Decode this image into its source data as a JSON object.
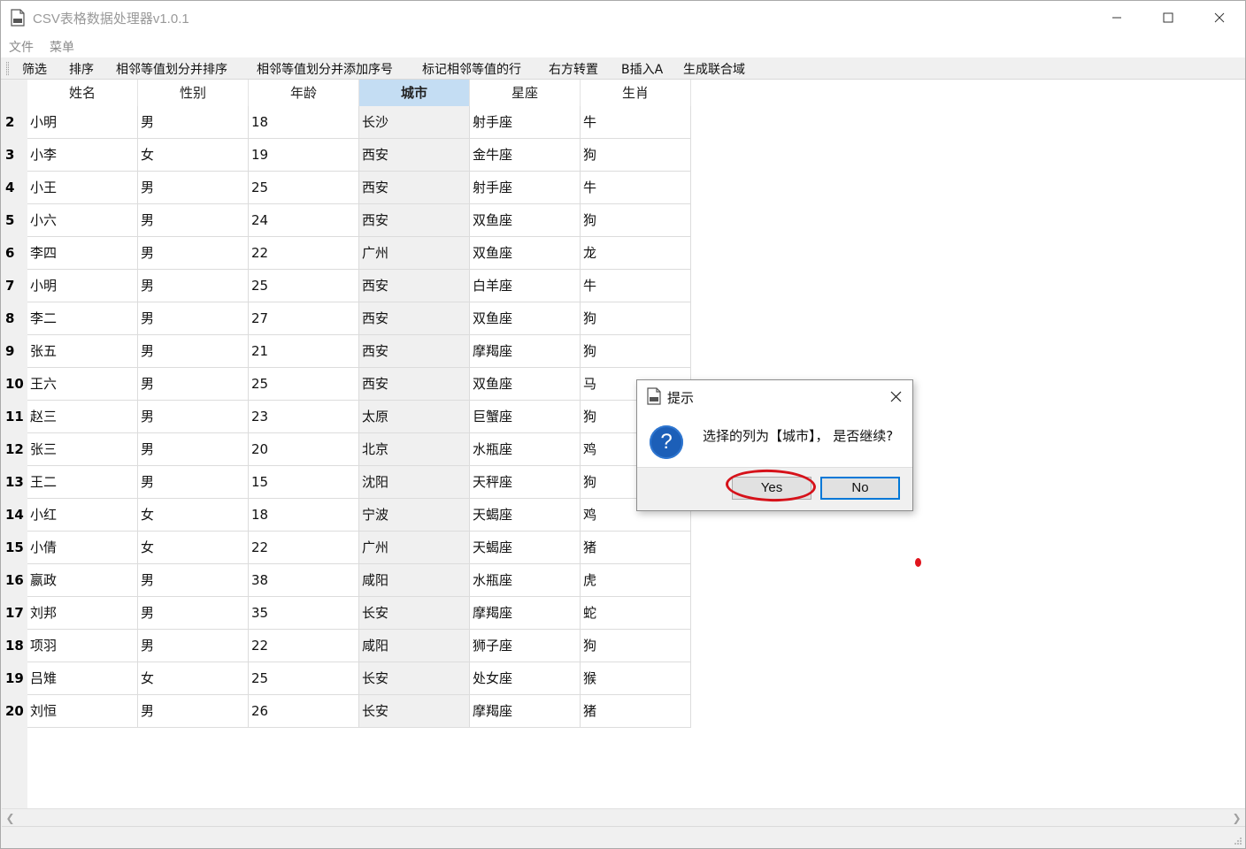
{
  "window": {
    "title": "CSV表格数据处理器v1.0.1"
  },
  "menu": {
    "items": [
      "文件",
      "菜单"
    ]
  },
  "toolbar": {
    "items": [
      "筛选",
      "排序",
      "相邻等值划分并排序",
      "相邻等值划分并添加序号",
      "标记相邻等值的行",
      "右方转置",
      "B插入A",
      "生成联合域"
    ]
  },
  "table": {
    "headers": [
      "姓名",
      "性别",
      "年龄",
      "城市",
      "星座",
      "生肖"
    ],
    "selected_column": "城市",
    "rows": [
      {
        "num": "2",
        "cells": [
          "小明",
          "男",
          "18",
          "长沙",
          "射手座",
          "牛"
        ]
      },
      {
        "num": "3",
        "cells": [
          "小李",
          "女",
          "19",
          "西安",
          "金牛座",
          "狗"
        ]
      },
      {
        "num": "4",
        "cells": [
          "小王",
          "男",
          "25",
          "西安",
          "射手座",
          "牛"
        ]
      },
      {
        "num": "5",
        "cells": [
          "小六",
          "男",
          "24",
          "西安",
          "双鱼座",
          "狗"
        ]
      },
      {
        "num": "6",
        "cells": [
          "李四",
          "男",
          "22",
          "广州",
          "双鱼座",
          "龙"
        ]
      },
      {
        "num": "7",
        "cells": [
          "小明",
          "男",
          "25",
          "西安",
          "白羊座",
          "牛"
        ]
      },
      {
        "num": "8",
        "cells": [
          "李二",
          "男",
          "27",
          "西安",
          "双鱼座",
          "狗"
        ]
      },
      {
        "num": "9",
        "cells": [
          "张五",
          "男",
          "21",
          "西安",
          "摩羯座",
          "狗"
        ]
      },
      {
        "num": "10",
        "cells": [
          "王六",
          "男",
          "25",
          "西安",
          "双鱼座",
          "马"
        ]
      },
      {
        "num": "11",
        "cells": [
          "赵三",
          "男",
          "23",
          "太原",
          "巨蟹座",
          "狗"
        ]
      },
      {
        "num": "12",
        "cells": [
          "张三",
          "男",
          "20",
          "北京",
          "水瓶座",
          "鸡"
        ]
      },
      {
        "num": "13",
        "cells": [
          "王二",
          "男",
          "15",
          "沈阳",
          "天秤座",
          "狗"
        ]
      },
      {
        "num": "14",
        "cells": [
          "小红",
          "女",
          "18",
          "宁波",
          "天蝎座",
          "鸡"
        ]
      },
      {
        "num": "15",
        "cells": [
          "小倩",
          "女",
          "22",
          "广州",
          "天蝎座",
          "猪"
        ]
      },
      {
        "num": "16",
        "cells": [
          "嬴政",
          "男",
          "38",
          "咸阳",
          "水瓶座",
          "虎"
        ]
      },
      {
        "num": "17",
        "cells": [
          "刘邦",
          "男",
          "35",
          "长安",
          "摩羯座",
          "蛇"
        ]
      },
      {
        "num": "18",
        "cells": [
          "项羽",
          "男",
          "22",
          "咸阳",
          "狮子座",
          "狗"
        ]
      },
      {
        "num": "19",
        "cells": [
          "吕雉",
          "女",
          "25",
          "长安",
          "处女座",
          "猴"
        ]
      },
      {
        "num": "20",
        "cells": [
          "刘恒",
          "男",
          "26",
          "长安",
          "摩羯座",
          "猪"
        ]
      }
    ]
  },
  "dialog": {
    "title": "提示",
    "message": "选择的列为【城市】， 是否继续?",
    "icon": "question-icon",
    "yes_label": "Yes",
    "no_label": "No"
  },
  "colors": {
    "selected_header": "#c4ddf3",
    "selected_column_bg": "#f0f0f0",
    "annotation_red": "#d6121a",
    "question_icon_blue": "#1c5fb8",
    "default_button_border": "#0078d7"
  }
}
